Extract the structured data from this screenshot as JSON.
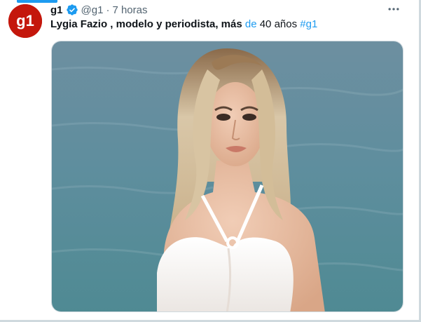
{
  "tweet": {
    "author_name": "g1",
    "handle": "@g1",
    "separator": "·",
    "time": "7 horas",
    "text_bold": "Lygia Fazio , modelo y periodista, más",
    "text_de": "de",
    "text_age": "40 años",
    "hashtag": "#g1"
  },
  "avatar": {
    "logo_text": "g1",
    "brand_color": "#c4170c"
  },
  "icons": {
    "verified": "verified-badge-icon",
    "more": "more-horizontal-icon"
  },
  "colors": {
    "accent": "#1d9bf0",
    "text": "#0f1419",
    "secondary": "#536471"
  }
}
